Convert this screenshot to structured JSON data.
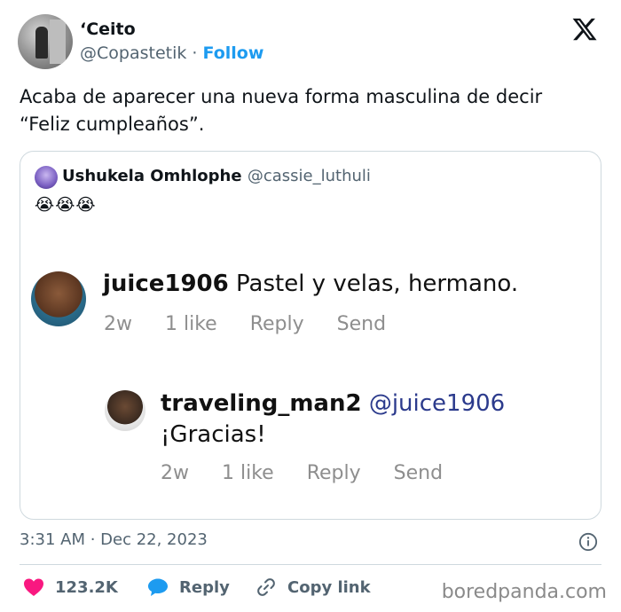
{
  "author": {
    "name": "‘Ceito",
    "handle": "@Copastetik",
    "separator": " · ",
    "follow_label": "Follow"
  },
  "tweet": {
    "text": "Acaba de aparecer una nueva forma masculina de decir “Feliz cumpleaños”."
  },
  "quoted": {
    "name": "Ushukela Omhlophe",
    "handle": "@cassie_luthuli",
    "emojis": "😭😭😭",
    "comments": [
      {
        "user": "juice1906",
        "text": "Pastel y velas, hermano.",
        "age": "2w",
        "likes": "1 like",
        "reply": "Reply",
        "send": "Send"
      },
      {
        "user": "traveling_man2",
        "mention": "@juice1906",
        "text": "¡Gracias!",
        "age": "2w",
        "likes": "1 like",
        "reply": "Reply",
        "send": "Send"
      }
    ]
  },
  "timestamp": "3:31 AM · Dec 22, 2023",
  "actions": {
    "likes": "123.2K",
    "reply": "Reply",
    "copy_link": "Copy link"
  },
  "watermark": "boredpanda.com",
  "colors": {
    "accent": "#1d9bf0",
    "like": "#f91880",
    "muted": "#536471",
    "border": "#cfd9de"
  },
  "icons": [
    "x-logo-icon",
    "info-icon",
    "heart-icon",
    "reply-bubble-icon",
    "link-icon"
  ]
}
